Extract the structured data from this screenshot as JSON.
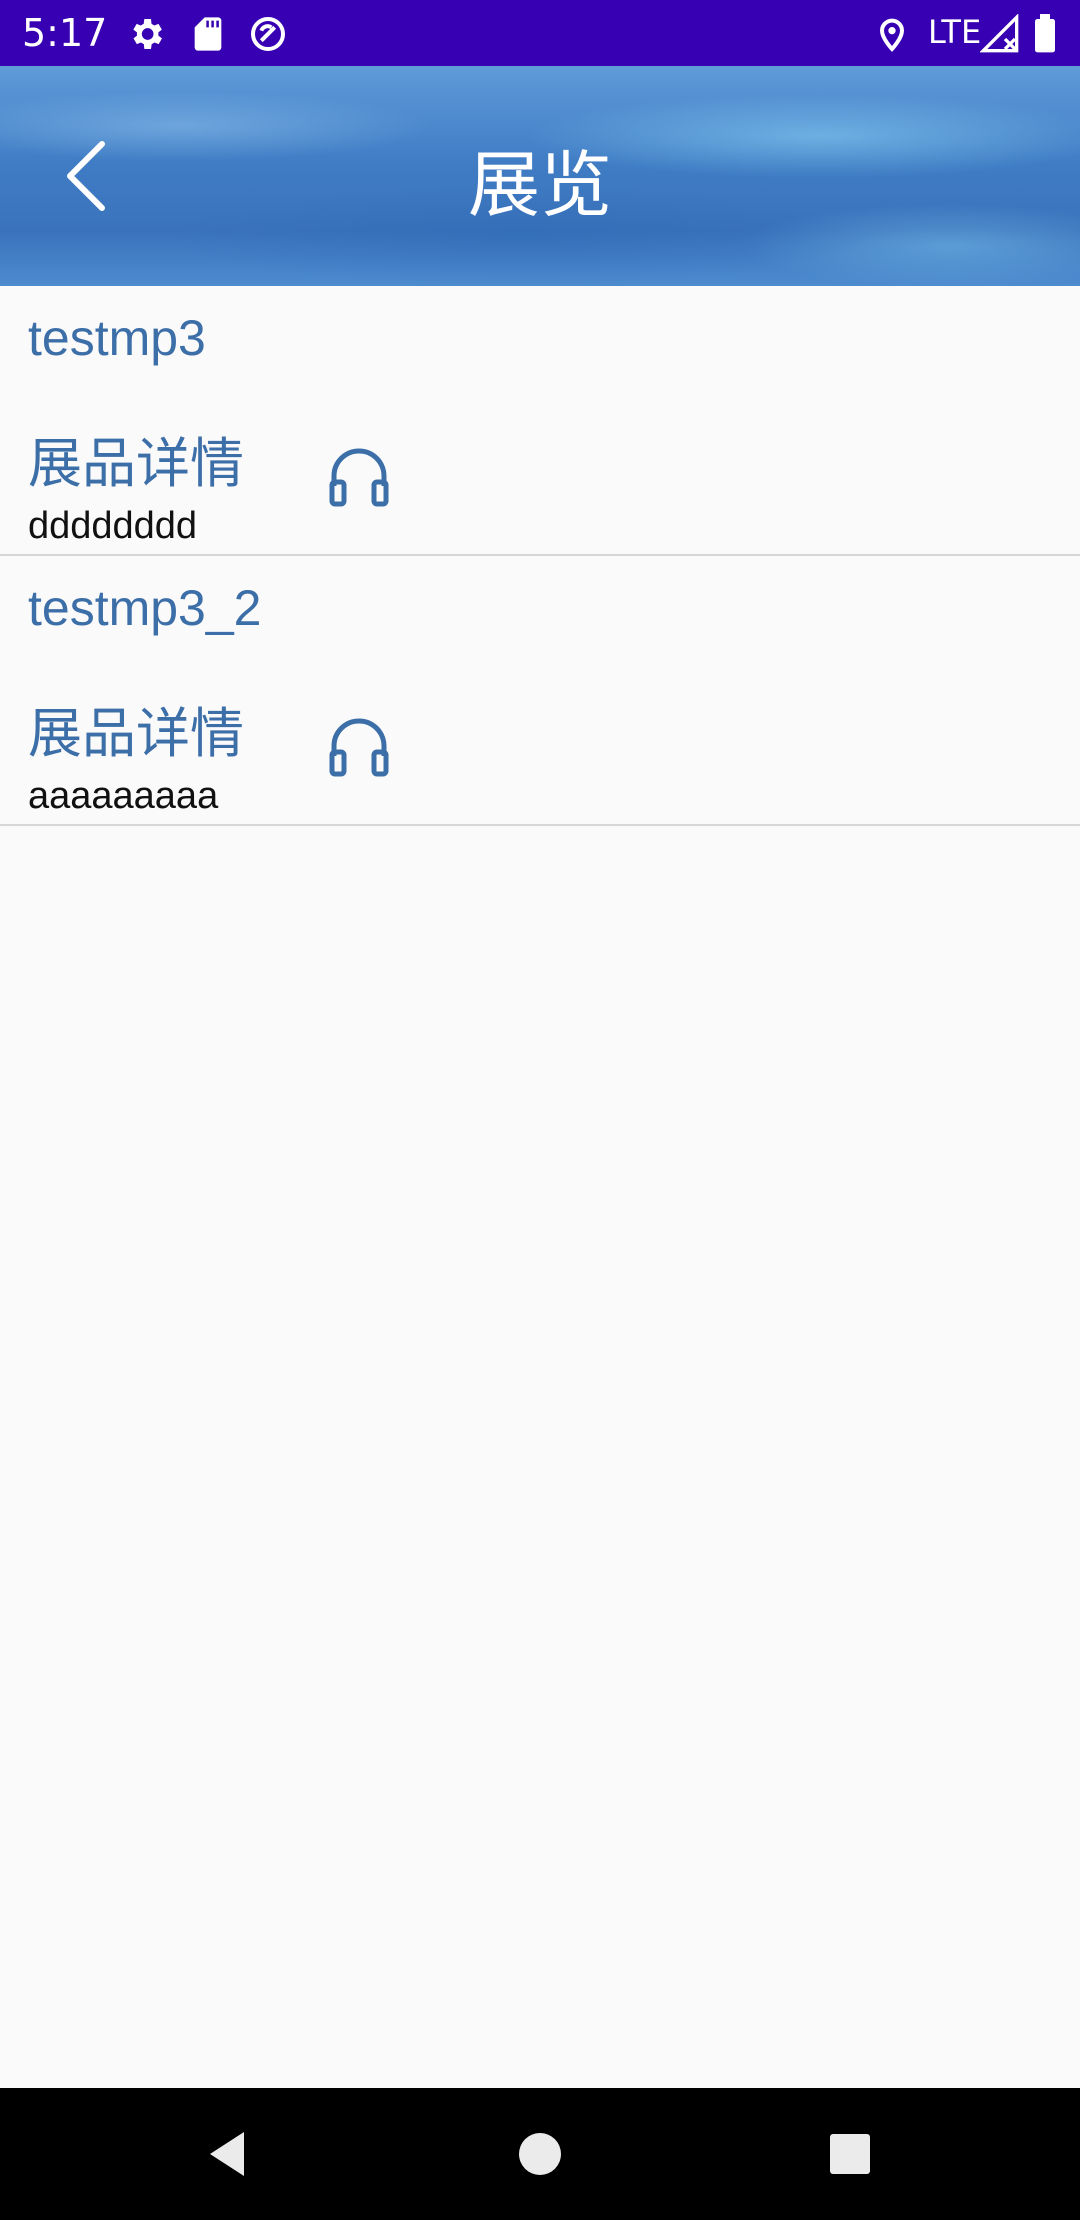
{
  "status_bar": {
    "time": "5:17",
    "left_icons": [
      "gear-icon",
      "sd-card-icon",
      "sync-icon"
    ],
    "network_label": "LTE",
    "right_icons": [
      "location-icon",
      "signal-icon",
      "battery-icon"
    ],
    "background_color": "#3700b3"
  },
  "header": {
    "title": "展览",
    "back_icon": "chevron-left-icon"
  },
  "exhibits": [
    {
      "name": "testmp3",
      "detail_label": "展品详情",
      "audio_icon": "headphones-icon",
      "description": "dddddddd"
    },
    {
      "name": "testmp3_2",
      "detail_label": "展品详情",
      "audio_icon": "headphones-icon",
      "description": "aaaaaaaaa"
    }
  ],
  "nav_bar": {
    "buttons": [
      "back-triangle-icon",
      "home-circle-icon",
      "recents-square-icon"
    ]
  },
  "colors": {
    "accent_text": "#3c6ea8",
    "status_bar": "#3700b3",
    "background": "#fafafa"
  }
}
